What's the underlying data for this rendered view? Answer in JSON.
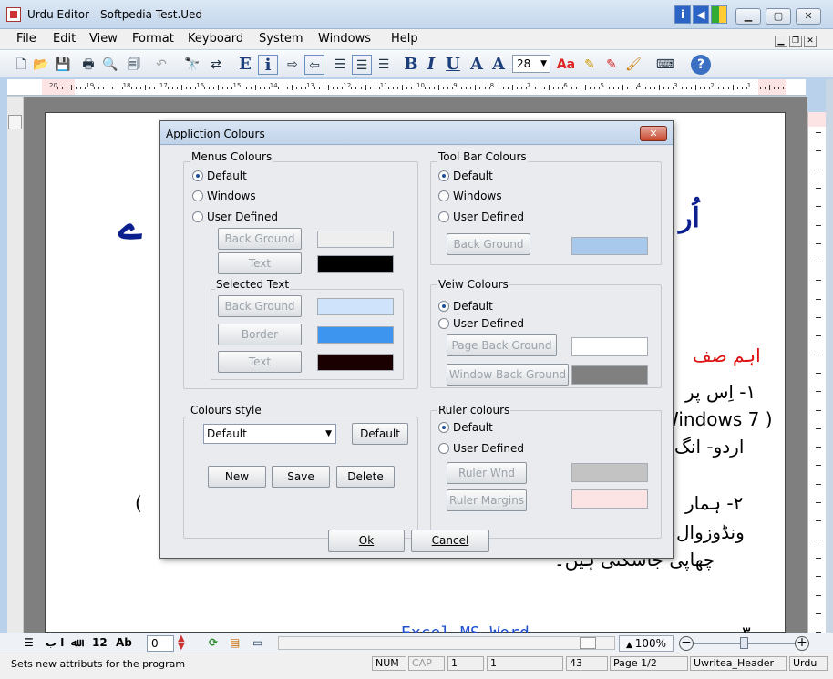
{
  "window": {
    "title": "Urdu Editor - Softpedia Test.Ued"
  },
  "menu": {
    "file": "File",
    "edit": "Edit",
    "view": "View",
    "format": "Format",
    "keyboard": "Keyboard",
    "system": "System",
    "windows": "Windows",
    "help": "Help"
  },
  "toolbar": {
    "font_size": "28"
  },
  "ruler": {
    "top_numbers": [
      "20",
      "19",
      "18",
      "17",
      "16",
      "15",
      "14",
      "13",
      "12",
      "11",
      "10",
      "9",
      "8",
      "7",
      "6",
      "5",
      "4",
      "3",
      "2",
      "1"
    ]
  },
  "document": {
    "red_heading": "اہم صف",
    "lines": [
      "١- اِس پر",
      "Windows 7 )",
      "اردو- انگ",
      "٢- ہمار",
      "(",
      "ونڈوزوال",
      "چھاپی جاسکتی ہیں۔"
    ],
    "footer_line": "Excel MS Word",
    "num3": "٣"
  },
  "dialog": {
    "title": "Appliction Colours",
    "menus_colours": {
      "label": "Menus Colours",
      "radios": [
        "Default",
        "Windows",
        "User Defined"
      ],
      "back_ground": "Back Ground",
      "text": "Text",
      "selected_text": {
        "label": "Selected Text",
        "back_ground": "Back Ground",
        "border": "Border",
        "text": "Text"
      }
    },
    "toolbar_colours": {
      "label": "Tool Bar Colours",
      "radios": [
        "Default",
        "Windows",
        "User Defined"
      ],
      "back_ground": "Back Ground"
    },
    "view_colours": {
      "label": "Veiw Colours",
      "radios": [
        "Default",
        "User Defined"
      ],
      "page_back_ground": "Page Back Ground",
      "window_back_ground": "Window Back Ground"
    },
    "colours_style": {
      "label": "Colours style",
      "selected": "Default",
      "default_button": "Default",
      "new": "New",
      "save": "Save",
      "delete": "Delete"
    },
    "ruler_colours": {
      "label": "Ruler colours",
      "radios": [
        "Default",
        "User Defined"
      ],
      "ruler_wnd": "Ruler Wnd",
      "ruler_margins": "Ruler Margins"
    },
    "ok": "Ok",
    "cancel": "Cancel"
  },
  "swatches": {
    "menu_bg": "#eeeeee",
    "menu_text": "#000000",
    "sel_bg": "#cfe4fa",
    "sel_border": "#3d95f0",
    "sel_text": "#1a0000",
    "toolbar_bg": "#a8c9ec",
    "page_bg": "#ffffff",
    "window_bg": "#808080",
    "ruler_wnd": "#c3c3c3",
    "ruler_margins": "#fde4e4"
  },
  "bottombar": {
    "alef": "ا ب",
    "count": "12",
    "ab": "Ab",
    "spin_value": "0",
    "zoom": "100%"
  },
  "status": {
    "text": "Sets new attributs for the program",
    "num": "NUM",
    "cap": "CAP",
    "f1": "1",
    "f2": "1",
    "f3": "43",
    "page": "Page 1/2",
    "style": "Uwritea_Header",
    "lang": "Urdu"
  }
}
